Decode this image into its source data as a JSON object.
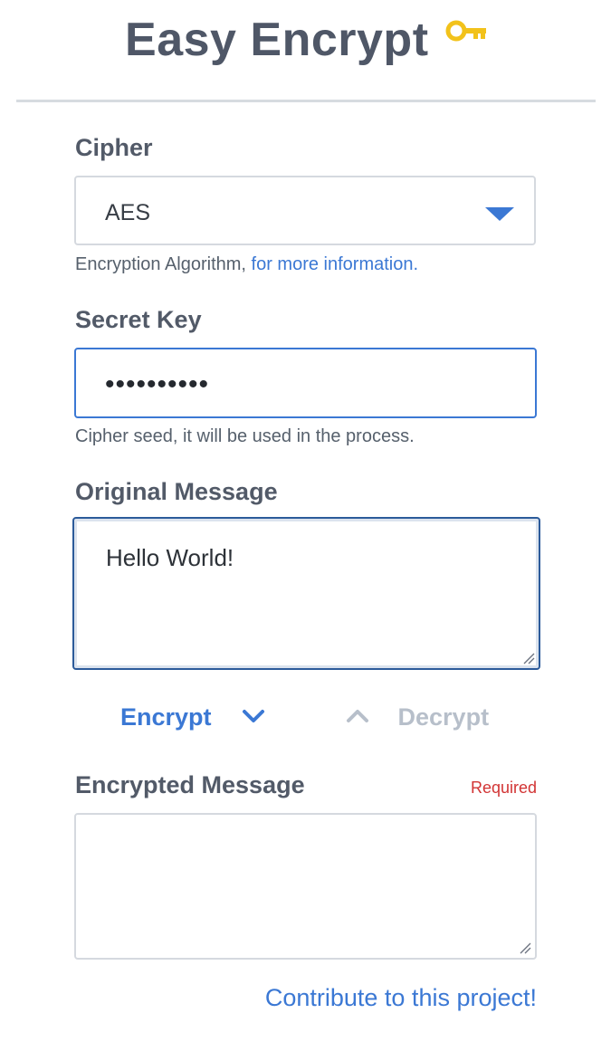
{
  "app": {
    "title": "Easy Encrypt",
    "icon": "key-icon",
    "accent_color": "#3b78d4",
    "key_color": "#f2c21b",
    "error_color": "#d23434"
  },
  "cipher": {
    "label": "Cipher",
    "selected": "AES",
    "help_text": "Encryption Algorithm, ",
    "help_link": "for more information."
  },
  "secret_key": {
    "label": "Secret Key",
    "value": "••••••••••",
    "help_text": "Cipher seed, it will be used in the process."
  },
  "original_message": {
    "label": "Original Message",
    "value": "Hello World!"
  },
  "actions": {
    "encrypt": "Encrypt",
    "decrypt": "Decrypt"
  },
  "encrypted_message": {
    "label": "Encrypted Message",
    "required": "Required",
    "value": ""
  },
  "footer": {
    "contribute_link": "Contribute to this project!"
  }
}
